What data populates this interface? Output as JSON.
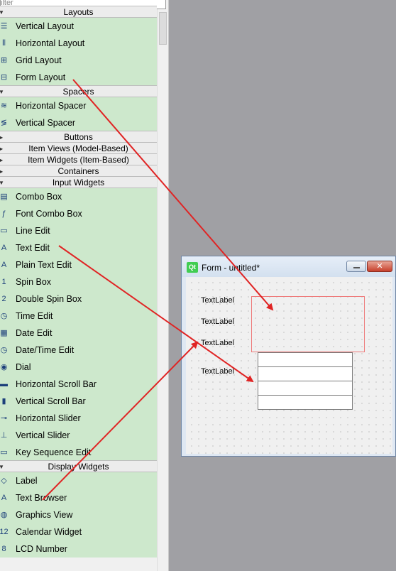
{
  "filter": {
    "placeholder": "ilter"
  },
  "widget_box": {
    "categories": [
      {
        "label": "Layouts",
        "expanded": true,
        "items": [
          {
            "label": "Vertical Layout",
            "icon": "vertical-layout-icon",
            "glyph": "☰"
          },
          {
            "label": "Horizontal Layout",
            "icon": "horizontal-layout-icon",
            "glyph": "⦀"
          },
          {
            "label": "Grid Layout",
            "icon": "grid-layout-icon",
            "glyph": "⊞"
          },
          {
            "label": "Form Layout",
            "icon": "form-layout-icon",
            "glyph": "⊟"
          }
        ]
      },
      {
        "label": "Spacers",
        "expanded": true,
        "items": [
          {
            "label": "Horizontal Spacer",
            "icon": "horizontal-spacer-icon",
            "glyph": "≋"
          },
          {
            "label": "Vertical Spacer",
            "icon": "vertical-spacer-icon",
            "glyph": "≶"
          }
        ]
      },
      {
        "label": "Buttons",
        "expanded": false,
        "items": []
      },
      {
        "label": "Item Views (Model-Based)",
        "expanded": false,
        "items": []
      },
      {
        "label": "Item Widgets (Item-Based)",
        "expanded": false,
        "items": []
      },
      {
        "label": "Containers",
        "expanded": false,
        "items": []
      },
      {
        "label": "Input Widgets",
        "expanded": true,
        "items": [
          {
            "label": "Combo Box",
            "icon": "combo-box-icon",
            "glyph": "▤"
          },
          {
            "label": "Font Combo Box",
            "icon": "font-combo-box-icon",
            "glyph": "ƒ"
          },
          {
            "label": "Line Edit",
            "icon": "line-edit-icon",
            "glyph": "▭"
          },
          {
            "label": "Text Edit",
            "icon": "text-edit-icon",
            "glyph": "A"
          },
          {
            "label": "Plain Text Edit",
            "icon": "plain-text-edit-icon",
            "glyph": "A"
          },
          {
            "label": "Spin Box",
            "icon": "spin-box-icon",
            "glyph": "1"
          },
          {
            "label": "Double Spin Box",
            "icon": "double-spin-box-icon",
            "glyph": "2"
          },
          {
            "label": "Time Edit",
            "icon": "time-edit-icon",
            "glyph": "◷"
          },
          {
            "label": "Date Edit",
            "icon": "date-edit-icon",
            "glyph": "▦"
          },
          {
            "label": "Date/Time Edit",
            "icon": "date-time-edit-icon",
            "glyph": "◷"
          },
          {
            "label": "Dial",
            "icon": "dial-icon",
            "glyph": "◉"
          },
          {
            "label": "Horizontal Scroll Bar",
            "icon": "horizontal-scroll-bar-icon",
            "glyph": "▬"
          },
          {
            "label": "Vertical Scroll Bar",
            "icon": "vertical-scroll-bar-icon",
            "glyph": "▮"
          },
          {
            "label": "Horizontal Slider",
            "icon": "horizontal-slider-icon",
            "glyph": "⊸"
          },
          {
            "label": "Vertical Slider",
            "icon": "vertical-slider-icon",
            "glyph": "⊥"
          },
          {
            "label": "Key Sequence Edit",
            "icon": "key-sequence-edit-icon",
            "glyph": "▭"
          }
        ]
      },
      {
        "label": "Display Widgets",
        "expanded": true,
        "items": [
          {
            "label": "Label",
            "icon": "label-icon",
            "glyph": "◇"
          },
          {
            "label": "Text Browser",
            "icon": "text-browser-icon",
            "glyph": "A"
          },
          {
            "label": "Graphics View",
            "icon": "graphics-view-icon",
            "glyph": "◍"
          },
          {
            "label": "Calendar Widget",
            "icon": "calendar-widget-icon",
            "glyph": "12"
          },
          {
            "label": "LCD Number",
            "icon": "lcd-number-icon",
            "glyph": "8"
          }
        ]
      }
    ]
  },
  "form": {
    "title": "Form - untitled*",
    "qt_logo": "Qt",
    "close_glyph": "✕",
    "labels": [
      "TextLabel",
      "TextLabel",
      "TextLabel",
      "TextLabel"
    ]
  },
  "colors": {
    "item_bg": "#cde8cc",
    "category_bg": "#ececec",
    "arrow": "#e02424",
    "designer_bg": "#a0a0a4"
  }
}
